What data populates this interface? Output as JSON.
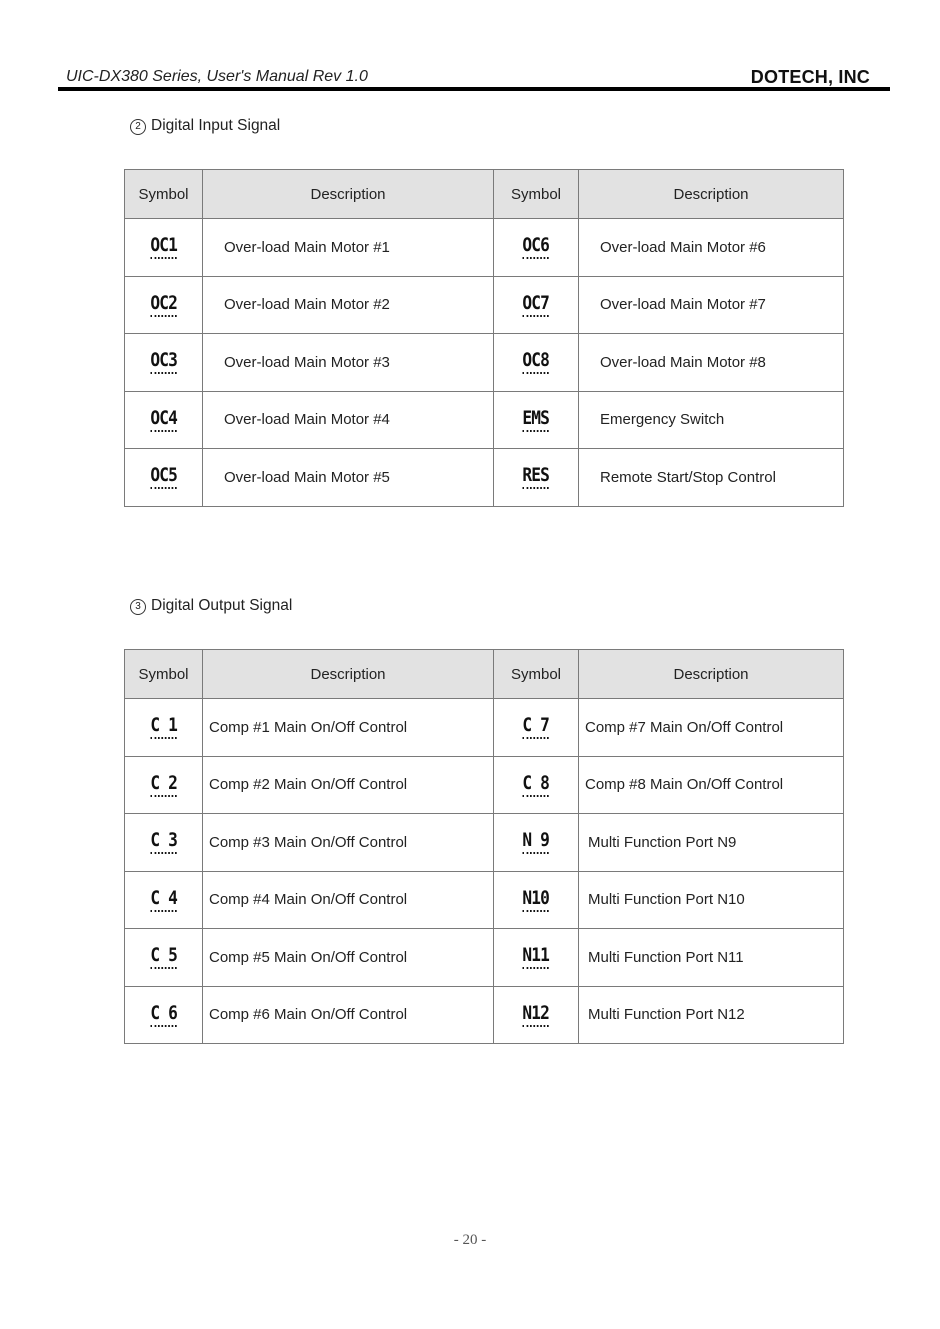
{
  "header": {
    "document_title": "UIC-DX380 Series, User's Manual Rev 1.0",
    "company": "DOTECH, INC"
  },
  "sections": [
    {
      "number": "2",
      "title": "Digital Input Signal",
      "columns": [
        "Symbol",
        "Description",
        "Symbol",
        "Description"
      ],
      "rows": [
        {
          "left_symbol": "OC1",
          "left_desc": "Over-load Main Motor #1",
          "right_symbol": "OC6",
          "right_desc": "Over-load Main Motor #6"
        },
        {
          "left_symbol": "OC2",
          "left_desc": "Over-load Main Motor #2",
          "right_symbol": "OC7",
          "right_desc": "Over-load Main Motor #7"
        },
        {
          "left_symbol": "OC3",
          "left_desc": "Over-load Main Motor #3",
          "right_symbol": "OC8",
          "right_desc": "Over-load Main Motor #8"
        },
        {
          "left_symbol": "OC4",
          "left_desc": "Over-load Main Motor #4",
          "right_symbol": "EMS",
          "right_desc": "Emergency Switch"
        },
        {
          "left_symbol": "OC5",
          "left_desc": "Over-load Main Motor #5",
          "right_symbol": "RES",
          "right_desc": "Remote Start/Stop Control"
        }
      ]
    },
    {
      "number": "3",
      "title": "Digital Output Signal",
      "columns": [
        "Symbol",
        "Description",
        "Symbol",
        "Description"
      ],
      "rows": [
        {
          "left_symbol": "C 1",
          "left_desc": "Comp #1 Main On/Off Control",
          "right_symbol": "C 7",
          "right_desc": "Comp #7 Main On/Off Control"
        },
        {
          "left_symbol": "C 2",
          "left_desc": "Comp #2 Main On/Off Control",
          "right_symbol": "C 8",
          "right_desc": "Comp #8 Main On/Off Control"
        },
        {
          "left_symbol": "C 3",
          "left_desc": "Comp #3 Main On/Off Control",
          "right_symbol": "N 9",
          "right_desc": "Multi Function Port N9"
        },
        {
          "left_symbol": "C 4",
          "left_desc": "Comp #4 Main On/Off Control",
          "right_symbol": "N10",
          "right_desc": "Multi Function Port N10"
        },
        {
          "left_symbol": "C 5",
          "left_desc": "Comp #5 Main On/Off Control",
          "right_symbol": "N11",
          "right_desc": "Multi Function Port N11"
        },
        {
          "left_symbol": "C 6",
          "left_desc": "Comp #6 Main On/Off Control",
          "right_symbol": "N12",
          "right_desc": "Multi Function Port N12"
        }
      ]
    }
  ],
  "footer": {
    "page_number": "- 20 -"
  }
}
